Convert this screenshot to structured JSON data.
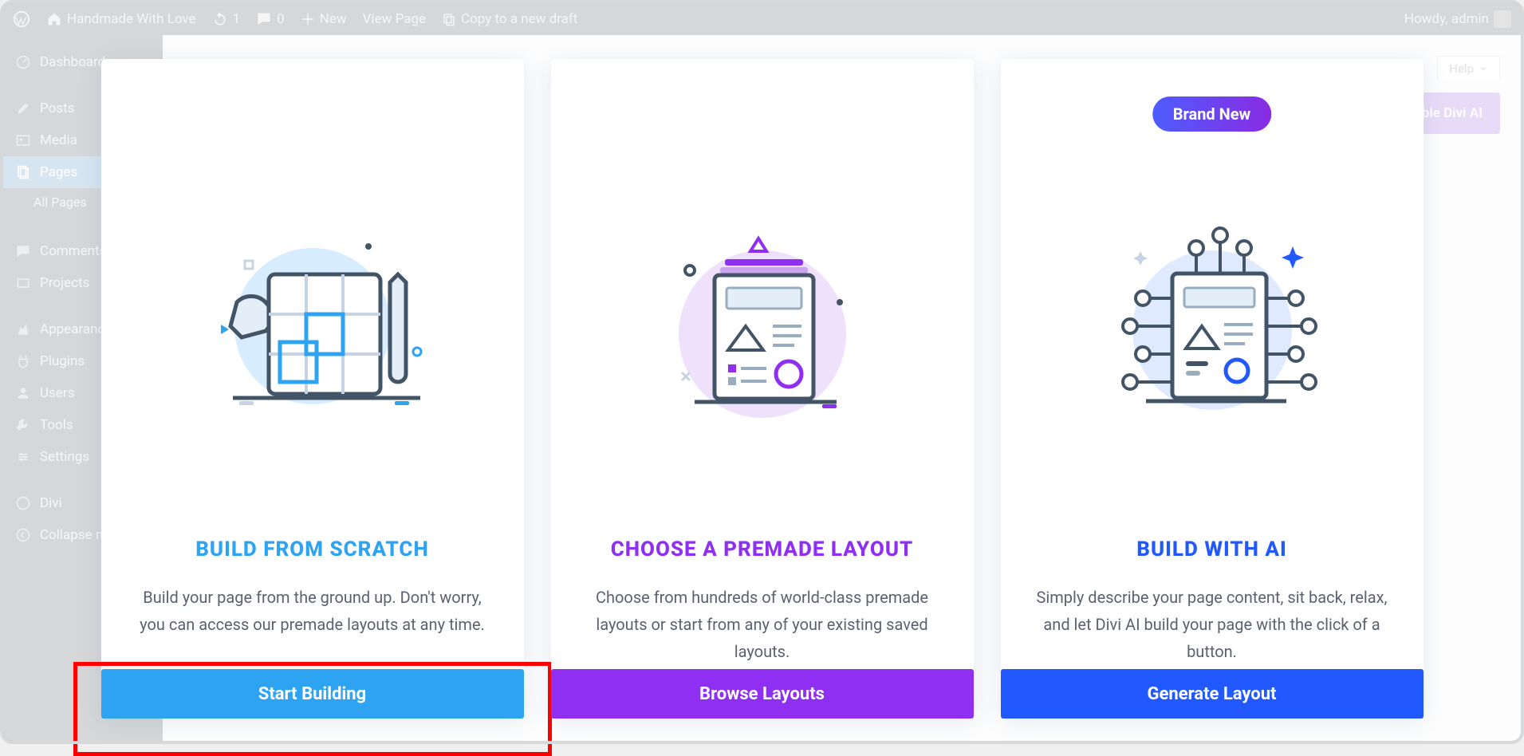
{
  "adminbar": {
    "site_name": "Handmade With Love",
    "comments_count": "0",
    "new_label": "New",
    "view_page_label": "View Page",
    "copy_draft_label": "Copy to a new draft",
    "howdy_label": "Howdy, admin"
  },
  "sidebar": {
    "items": [
      {
        "label": "Dashboard",
        "icon": "dashboard"
      },
      {
        "label": "Posts",
        "icon": "posts"
      },
      {
        "label": "Media",
        "icon": "media"
      },
      {
        "label": "Pages",
        "icon": "pages",
        "active": true
      },
      {
        "label": "Comments",
        "icon": "comments"
      },
      {
        "label": "Projects",
        "icon": "projects"
      },
      {
        "label": "Appearance",
        "icon": "appearance"
      },
      {
        "label": "Plugins",
        "icon": "plugins"
      },
      {
        "label": "Users",
        "icon": "users"
      },
      {
        "label": "Tools",
        "icon": "tools"
      },
      {
        "label": "Settings",
        "icon": "settings"
      },
      {
        "label": "Divi",
        "icon": "divi"
      },
      {
        "label": "Collapse menu",
        "icon": "collapse"
      }
    ],
    "sub_item": "All Pages"
  },
  "content_behind": {
    "help_label": "Help",
    "enable_ai_label": "Enable Divi AI"
  },
  "modal": {
    "cards": [
      {
        "title": "BUILD FROM SCRATCH",
        "desc": "Build your page from the ground up. Don't worry, you can access our premade layouts at any time.",
        "button": "Start Building"
      },
      {
        "title": "CHOOSE A PREMADE LAYOUT",
        "desc": "Choose from hundreds of world-class premade layouts or start from any of your existing saved layouts.",
        "button": "Browse Layouts"
      },
      {
        "badge": "Brand New",
        "title": "BUILD WITH AI",
        "desc": "Simply describe your page content, sit back, relax, and let Divi AI build your page with the click of a button.",
        "button": "Generate Layout"
      }
    ]
  }
}
